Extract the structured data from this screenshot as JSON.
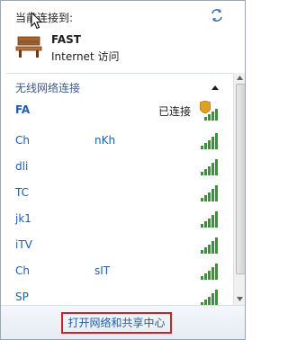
{
  "header": {
    "current_label": "当前连接到:"
  },
  "current_network": {
    "name": "FAST",
    "access": "Internet 访问"
  },
  "wireless_section": {
    "title": "无线网络连接"
  },
  "networks": [
    {
      "name": "FA",
      "status": "已连接"
    },
    {
      "name": "Ch      nKh",
      "status": ""
    },
    {
      "name": "dli",
      "status": ""
    },
    {
      "name": "TC",
      "status": ""
    },
    {
      "name": "jk1",
      "status": ""
    },
    {
      "name": "iTV",
      "status": ""
    },
    {
      "name": "Ch      sIT",
      "status": ""
    },
    {
      "name": "SP     ",
      "status": ""
    }
  ],
  "footer": {
    "open_center_label": "打开网络和共享中心"
  },
  "colors": {
    "link_blue": "#1e5fa8",
    "highlight_red": "#d42020",
    "signal_green": "#2f9a2f"
  }
}
